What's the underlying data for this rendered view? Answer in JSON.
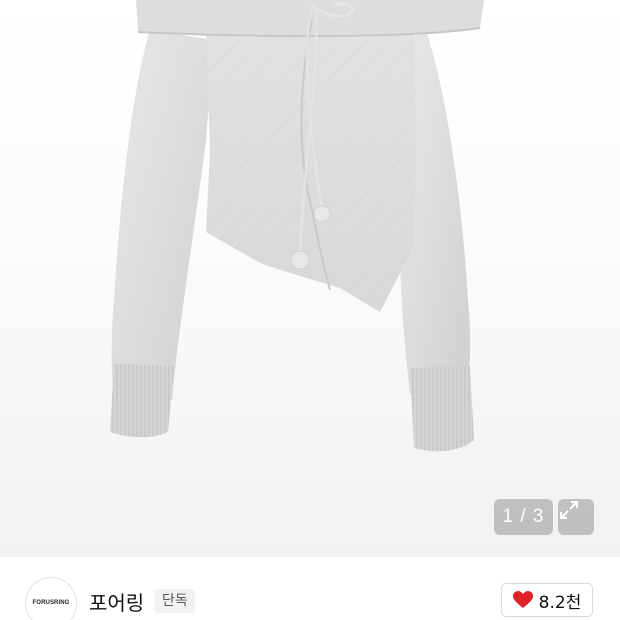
{
  "product_gallery": {
    "image_alt": "light grey off-shoulder knit sweater with asymmetric hem",
    "counter_text": "1 / 3",
    "expand_icon": "expand-arrows-icon"
  },
  "store": {
    "logo_text": "FORUSRING",
    "name": "포어링",
    "badge": "단독"
  },
  "like": {
    "icon": "heart-icon",
    "count": "8.2천",
    "heart_color": "#e0232b"
  }
}
